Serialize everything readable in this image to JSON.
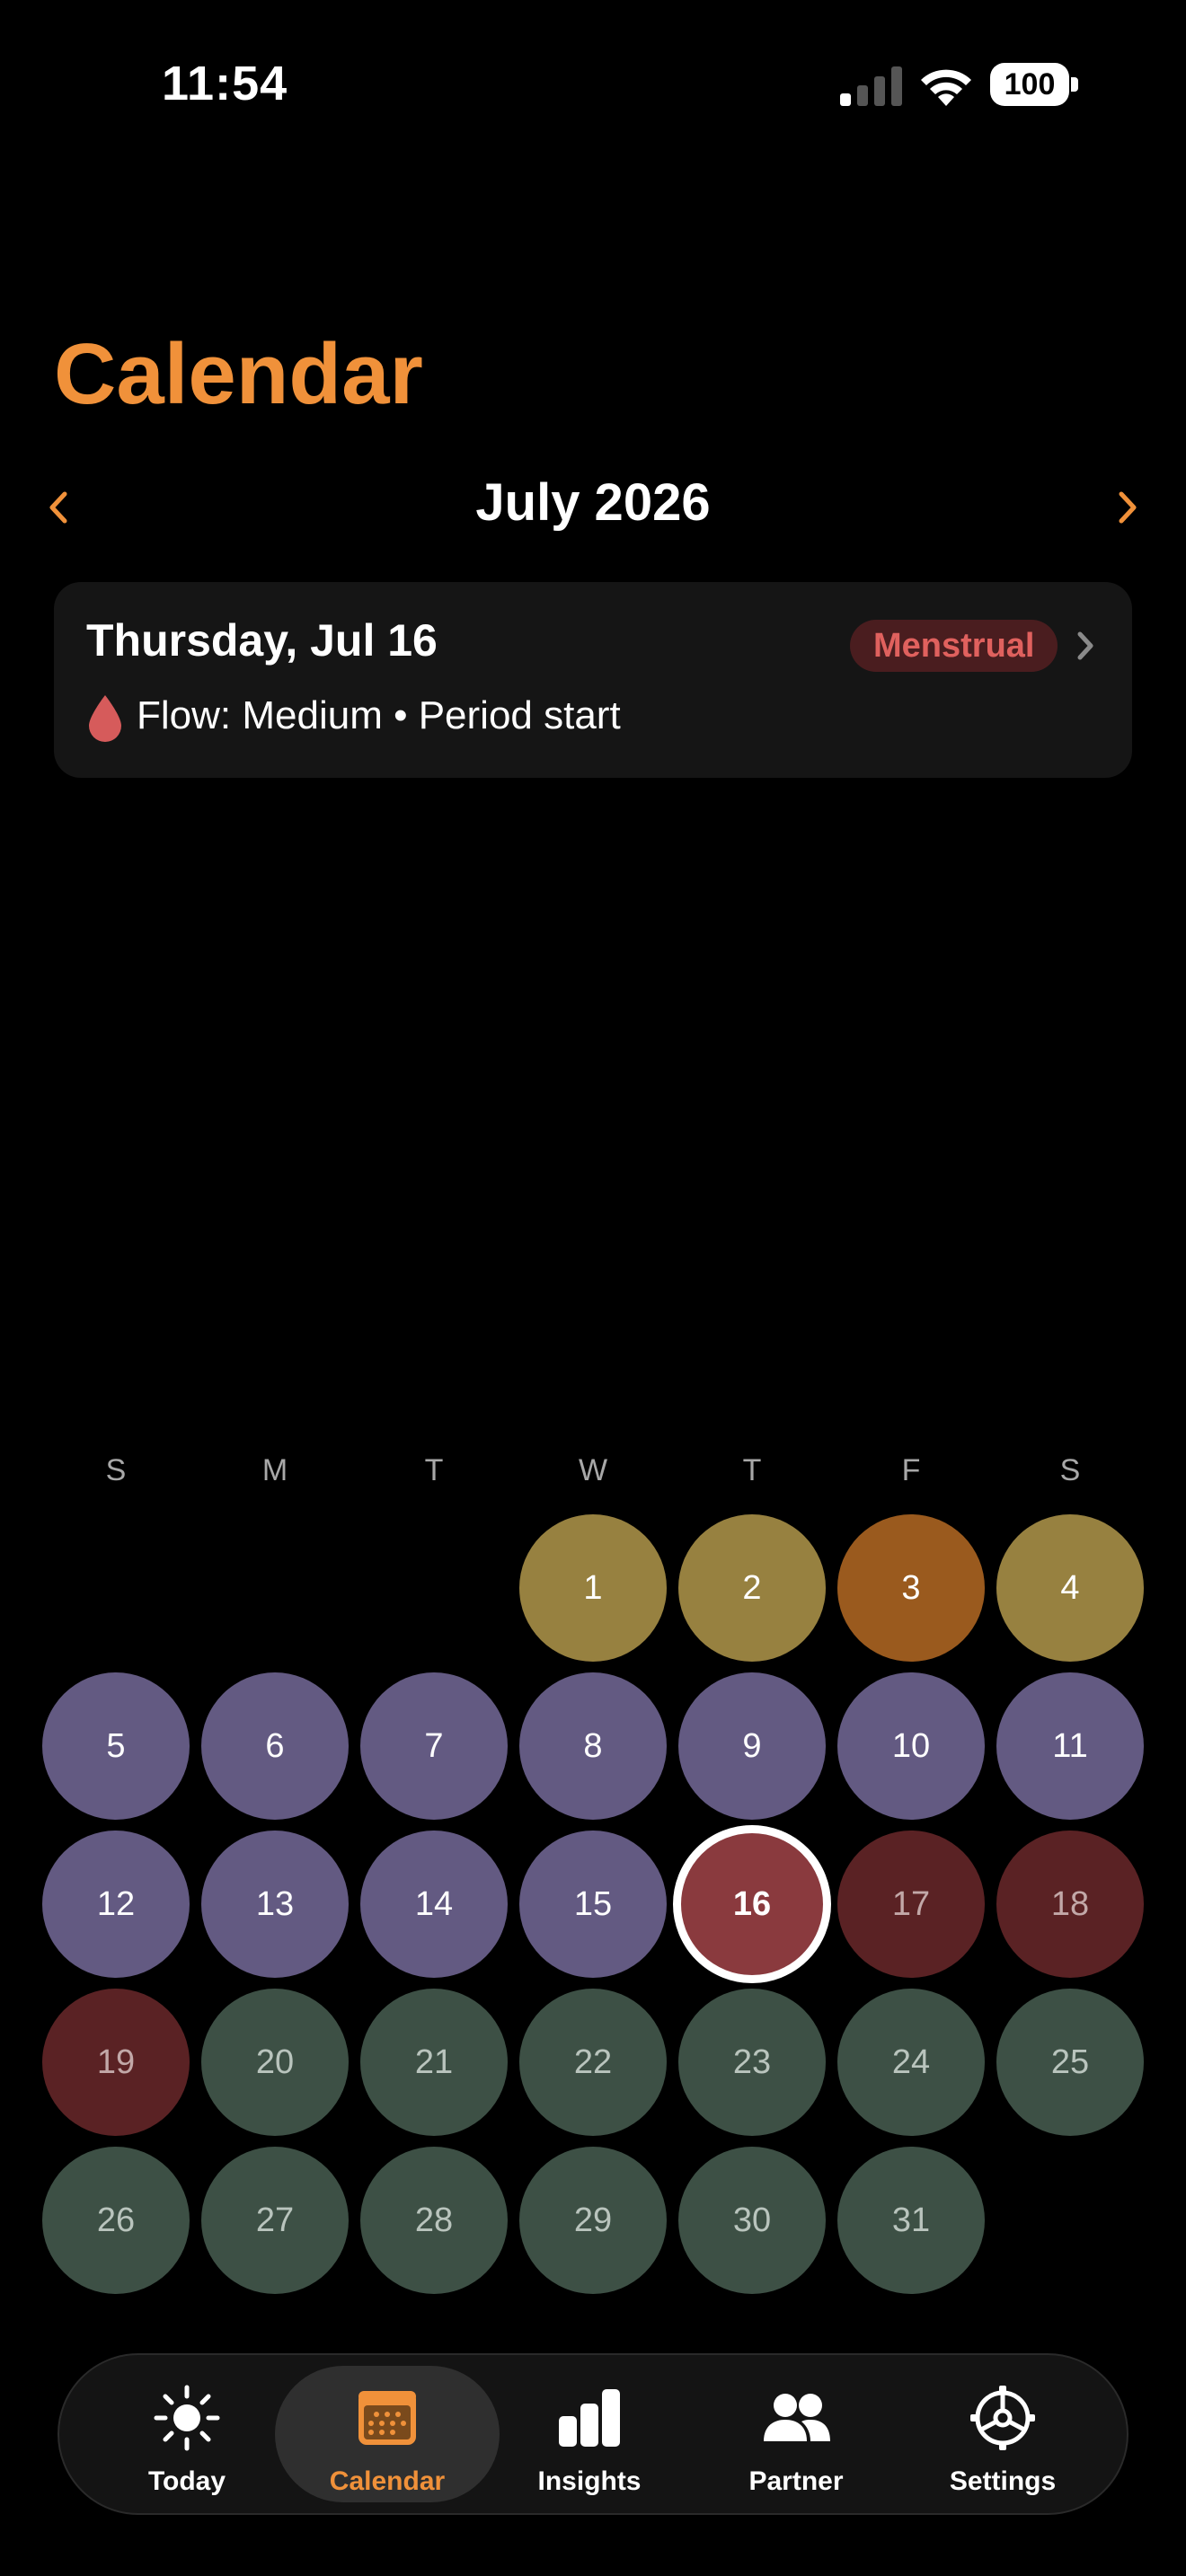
{
  "status_bar": {
    "time": "11:54",
    "battery": "100"
  },
  "page": {
    "title": "Calendar"
  },
  "month_nav": {
    "label": "July 2026"
  },
  "selected_day": {
    "date": "Thursday, Jul 16",
    "phase": "Menstrual",
    "detail": "Flow: Medium • Period start"
  },
  "colors": {
    "accent": "#f0913a",
    "follicular": "#635a82",
    "fertile": "#978140",
    "ovulation": "#9a5a1e",
    "menstrual": "#5a2224",
    "menstrual_selected": "#8a3a3e",
    "luteal": "#3d5045"
  },
  "weekdays": [
    "S",
    "M",
    "T",
    "W",
    "T",
    "F",
    "S"
  ],
  "days": [
    {
      "label": "1",
      "phase": "fertile"
    },
    {
      "label": "2",
      "phase": "fertile"
    },
    {
      "label": "3",
      "phase": "ovulation"
    },
    {
      "label": "4",
      "phase": "fertile"
    },
    {
      "label": "5",
      "phase": "follicular"
    },
    {
      "label": "6",
      "phase": "follicular"
    },
    {
      "label": "7",
      "phase": "follicular"
    },
    {
      "label": "8",
      "phase": "follicular"
    },
    {
      "label": "9",
      "phase": "follicular"
    },
    {
      "label": "10",
      "phase": "follicular"
    },
    {
      "label": "11",
      "phase": "follicular"
    },
    {
      "label": "12",
      "phase": "follicular"
    },
    {
      "label": "13",
      "phase": "follicular"
    },
    {
      "label": "14",
      "phase": "follicular"
    },
    {
      "label": "15",
      "phase": "follicular"
    },
    {
      "label": "16",
      "phase": "selected"
    },
    {
      "label": "17",
      "phase": "menstrual"
    },
    {
      "label": "18",
      "phase": "menstrual"
    },
    {
      "label": "19",
      "phase": "menstrual"
    },
    {
      "label": "20",
      "phase": "luteal"
    },
    {
      "label": "21",
      "phase": "luteal"
    },
    {
      "label": "22",
      "phase": "luteal"
    },
    {
      "label": "23",
      "phase": "luteal"
    },
    {
      "label": "24",
      "phase": "luteal"
    },
    {
      "label": "25",
      "phase": "luteal"
    },
    {
      "label": "26",
      "phase": "luteal"
    },
    {
      "label": "27",
      "phase": "luteal"
    },
    {
      "label": "28",
      "phase": "luteal"
    },
    {
      "label": "29",
      "phase": "luteal"
    },
    {
      "label": "30",
      "phase": "luteal"
    },
    {
      "label": "31",
      "phase": "luteal"
    }
  ],
  "tabs": [
    {
      "label": "Today",
      "icon": "sun-icon"
    },
    {
      "label": "Calendar",
      "icon": "calendar-icon",
      "active": true
    },
    {
      "label": "Insights",
      "icon": "bar-chart-icon"
    },
    {
      "label": "Partner",
      "icon": "people-icon"
    },
    {
      "label": "Settings",
      "icon": "gear-icon"
    }
  ]
}
